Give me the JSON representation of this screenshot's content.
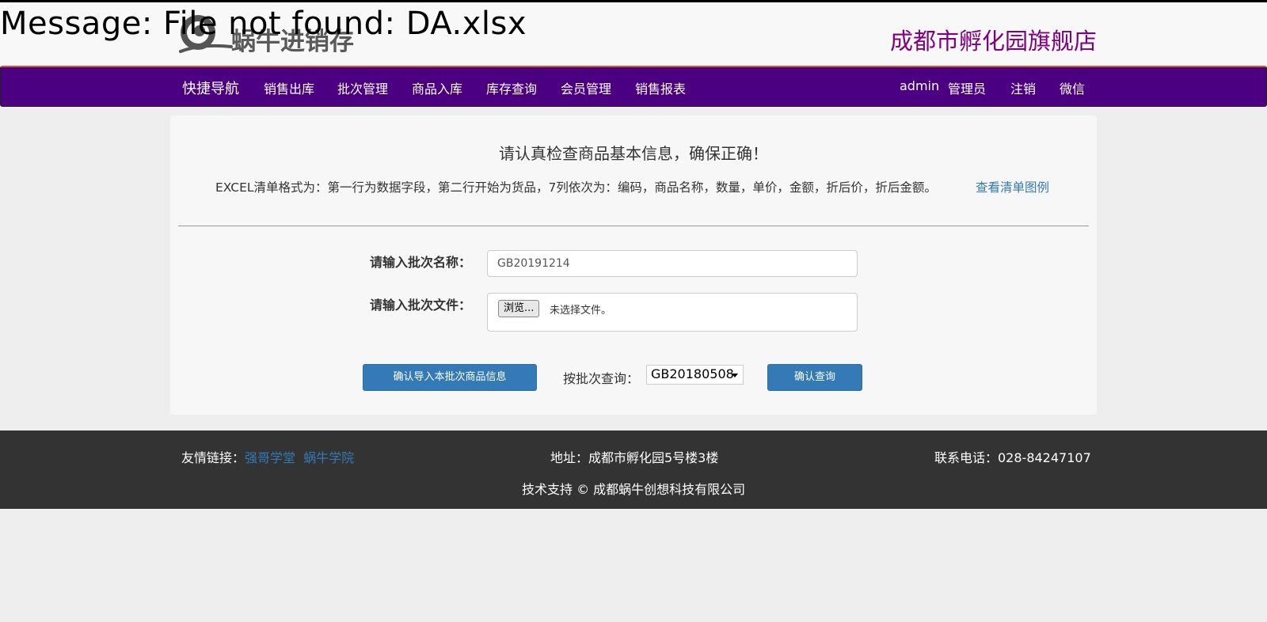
{
  "error_message": "Message: File not found: DA.xlsx",
  "header": {
    "logo_text": "蜗牛进销存",
    "store_name": "成都市孵化园旗舰店"
  },
  "nav": {
    "brand": "快捷导航",
    "items": [
      "销售出库",
      "批次管理",
      "商品入库",
      "库存查询",
      "会员管理",
      "销售报表"
    ],
    "user": "admin",
    "role": "管理员",
    "logout": "注销",
    "wechat": "微信"
  },
  "notice": {
    "title": "请认真检查商品基本信息，确保正确！",
    "description": "EXCEL清单格式为：第一行为数据字段，第二行开始为货品，7列依次为：编码，商品名称，数量，单价，金额，折后价，折后金额。",
    "example_link": "查看清单图例"
  },
  "form": {
    "batch_name_label": "请输入批次名称：",
    "batch_name_value": "GB20191214",
    "batch_file_label": "请输入批次文件：",
    "browse_button": "浏览...",
    "file_status": "未选择文件。",
    "import_button": "确认导入本批次商品信息",
    "query_label": "按批次查询：",
    "query_selected": "GB20180508",
    "query_button": "确认查询"
  },
  "footer": {
    "links_label": "友情链接：",
    "links": [
      "强哥学堂",
      "蜗牛学院"
    ],
    "address": "地址：成都市孵化园5号楼3楼",
    "phone": "联系电话：028-84247107",
    "support": "技术支持 © 成都蜗牛创想科技有限公司"
  },
  "colors": {
    "nav_bg": "#4b0082",
    "store_name": "#800080",
    "primary": "#337ab7",
    "footer_bg": "#333333"
  }
}
